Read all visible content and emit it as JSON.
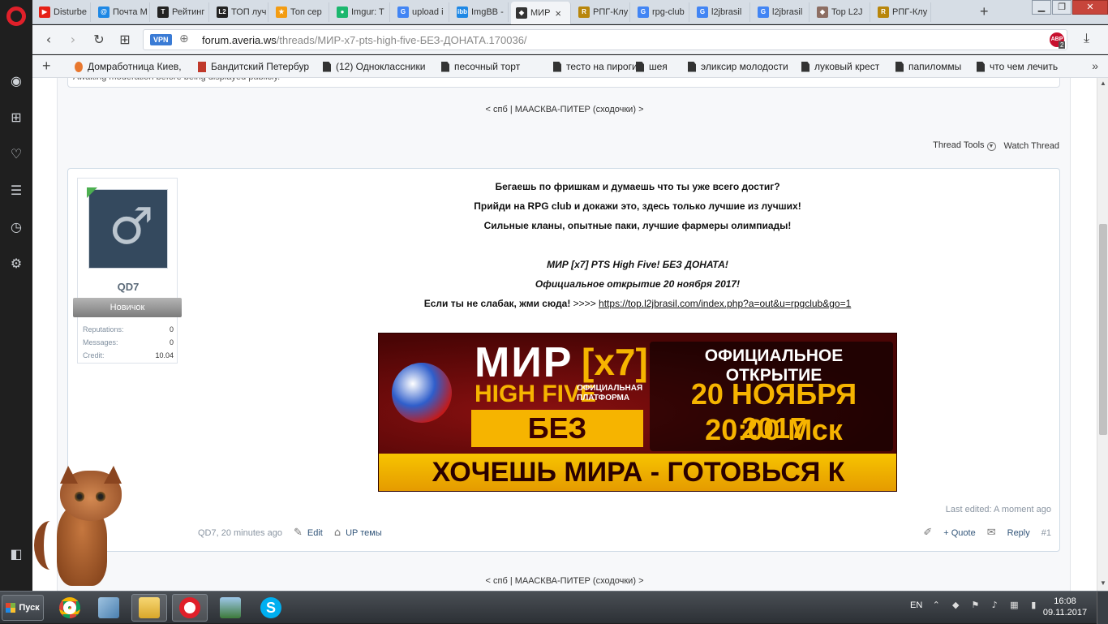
{
  "tabs": [
    {
      "title": "Disturbe",
      "fav_color": "#e62117",
      "fav_glyph": "▶"
    },
    {
      "title": "Почта М",
      "fav_color": "#1e88e5",
      "fav_glyph": "@"
    },
    {
      "title": "Рейтинг",
      "fav_color": "#222222",
      "fav_glyph": "T"
    },
    {
      "title": "ТОП луч",
      "fav_color": "#222222",
      "fav_glyph": "L2"
    },
    {
      "title": "Топ сер",
      "fav_color": "#f39c12",
      "fav_glyph": "★"
    },
    {
      "title": "Imgur: T",
      "fav_color": "#1bb76e",
      "fav_glyph": "●"
    },
    {
      "title": "upload i",
      "fav_color": "#4285f4",
      "fav_glyph": "G"
    },
    {
      "title": "ImgBB -",
      "fav_color": "#1e88e5",
      "fav_glyph": "ibb"
    },
    {
      "title": "МИР",
      "fav_color": "#333333",
      "fav_glyph": "◆",
      "active": true
    },
    {
      "title": "РПГ-Клу",
      "fav_color": "#b8860b",
      "fav_glyph": "R"
    },
    {
      "title": "rpg-club",
      "fav_color": "#4285f4",
      "fav_glyph": "G"
    },
    {
      "title": "l2jbrasil",
      "fav_color": "#4285f4",
      "fav_glyph": "G"
    },
    {
      "title": "l2jbrasil",
      "fav_color": "#4285f4",
      "fav_glyph": "G"
    },
    {
      "title": "Top L2J",
      "fav_color": "#8d6e63",
      "fav_glyph": "◆"
    },
    {
      "title": "РПГ-Клу",
      "fav_color": "#b8860b",
      "fav_glyph": "R"
    }
  ],
  "tab_close": "×",
  "new_tab": "+",
  "window": {
    "minimize": "▁",
    "restore": "❐",
    "close": "✕"
  },
  "nav": {
    "back": "‹",
    "forward": "›",
    "reload": "↻",
    "speed_dial": "⊞"
  },
  "address": {
    "vpn": "VPN",
    "domain": "forum.averia.ws",
    "path": "/threads/МИР-x7-pts-high-five-БЕЗ-ДОНАТА.170036/"
  },
  "adblock": {
    "label": "ABP",
    "count": "2"
  },
  "bookmarks": [
    "Домработница Киев,",
    "Бандитский Петербур",
    "(12) Одноклассники",
    "песочный торт",
    "тесто на пироги",
    "шея",
    "эликсир молодости",
    "луковый крест",
    "папиломмы",
    "что чем лечить"
  ],
  "prev_post_text": "Awaiting moderation before being displayed publicly.",
  "thread_nav": {
    "prefix": "<",
    "left": "спб",
    "sep": "|",
    "right": "МААСКВА-ПИТЕР (сходочки)",
    "suffix": ">"
  },
  "thread_tools": {
    "tools": "Thread Tools",
    "watch": "Watch Thread"
  },
  "user": {
    "name": "QD7",
    "rank": "Новичок",
    "stats": [
      {
        "label": "Reputations:",
        "value": "0"
      },
      {
        "label": "Messages:",
        "value": "0"
      },
      {
        "label": "Credit:",
        "value": "10.04"
      }
    ]
  },
  "message": {
    "line1": "Бегаешь по фришкам и думаешь что ты уже всего достиг?",
    "line2": "Прийди на RPG club и докажи это, здесь только лучшие из лучших!",
    "line3": "Сильные кланы, опытные паки, лучшие фармеры олимпиады!",
    "line4": "МИР [x7] PTS High Five! БЕЗ ДОНАТА!",
    "line5": "Официальное открытие 20 ноября 2017!",
    "line6_text": "Если ты не слабак, жми сюда!",
    "line6_arrows": " >>>> ",
    "link": "https://top.l2jbrasil.com/index.php?a=out&u=rpgclub&go=1"
  },
  "banner": {
    "mir": "МИР",
    "x7": "[x7]",
    "high_five": "HIGH FIVE",
    "platform": "ОФИЦИАЛЬНАЯ ПЛАТФОРМА",
    "no_donate": "БЕЗ ДОНАТА",
    "official_open": "ОФИЦИАЛЬНОЕ ОТКРЫТИЕ",
    "date": "20 НОЯБРЯ 2017",
    "time": "20:00 Мск",
    "slogan": "ХОЧЕШЬ МИРА - ГОТОВЬСЯ К ВОЙНЕ"
  },
  "post_meta": {
    "last_edited": "Last edited: A moment ago",
    "author_time": "QD7, 20 minutes ago",
    "edit": "Edit",
    "up": "UP темы",
    "quote": "+ Quote",
    "reply": "Reply",
    "number": "#1"
  },
  "taskbar": {
    "start": "Пуск",
    "lang": "EN",
    "time": "16:08",
    "date": "09.11.2017"
  }
}
